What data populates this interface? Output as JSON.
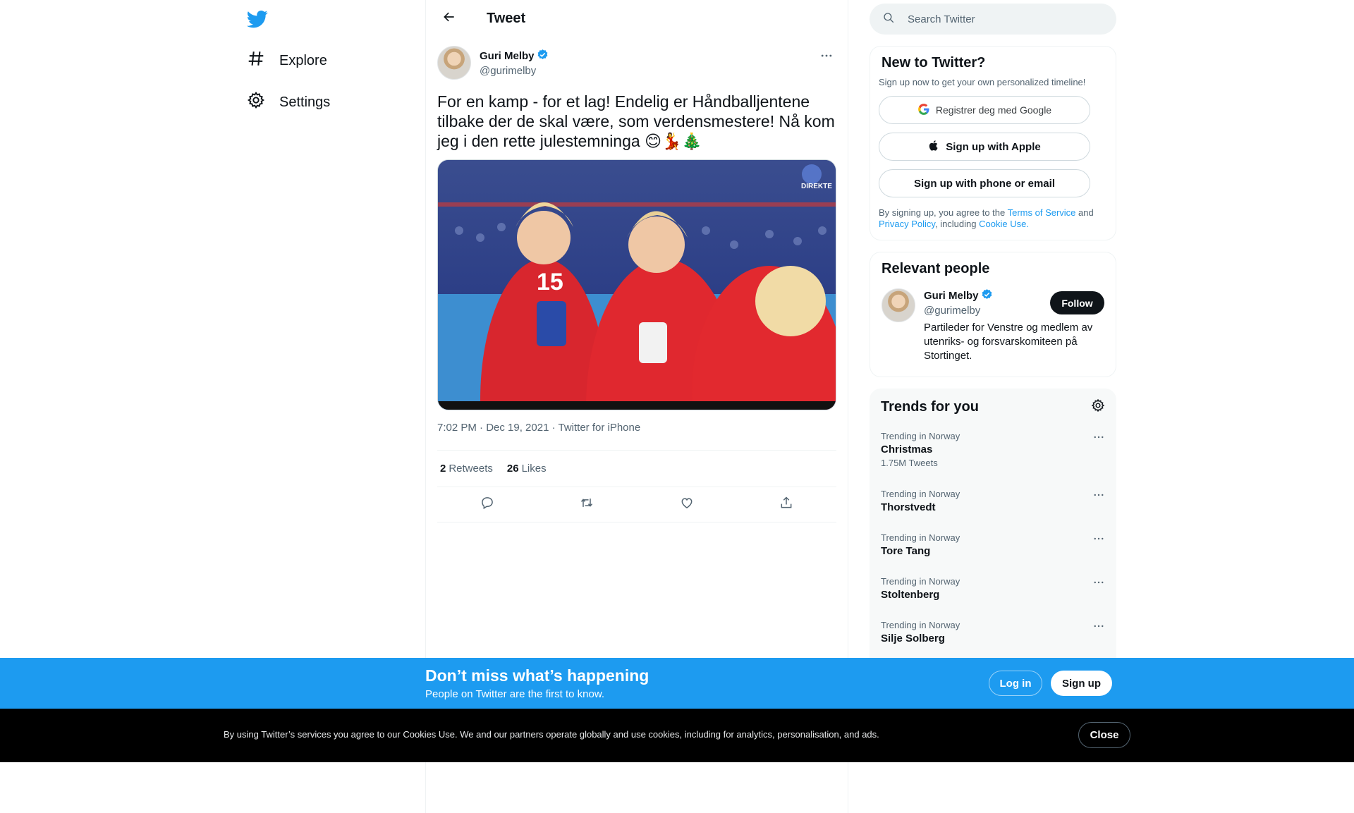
{
  "nav": {
    "explore_label": "Explore",
    "settings_label": "Settings"
  },
  "header": {
    "title": "Tweet"
  },
  "tweet": {
    "author_name": "Guri Melby",
    "author_handle": "@gurimelby",
    "text": "For en kamp - for et lag! Endelig er Håndballjentene tilbake der de skal være, som verdensmestere! Nå kom jeg i den rette julestemninga 😊💃🎄",
    "media_overlay_label": "DIREKTE",
    "jersey_number": "15",
    "meta": "7:02 PM · Dec 19, 2021 · Twitter for iPhone",
    "retweets_count": "2",
    "retweets_label": "Retweets",
    "likes_count": "26",
    "likes_label": "Likes"
  },
  "search": {
    "placeholder": "Search Twitter"
  },
  "signup": {
    "title": "New to Twitter?",
    "subtitle": "Sign up now to get your own personalized timeline!",
    "google_label": "Registrer deg med Google",
    "apple_label": "Sign up with Apple",
    "phone_label": "Sign up with phone or email",
    "legal_prefix": "By signing up, you agree to the ",
    "terms_link": "Terms of Service",
    "legal_and": " and",
    "privacy_link": "Privacy Policy",
    "legal_including": ", including ",
    "cookie_link": "Cookie Use."
  },
  "relevant": {
    "title": "Relevant people",
    "name": "Guri Melby",
    "handle": "@gurimelby",
    "bio": "Partileder for Venstre og medlem av utenriks- og forsvarskomiteen på Stortinget.",
    "follow_label": "Follow"
  },
  "trends": {
    "title": "Trends for you",
    "items": [
      {
        "context": "Trending in Norway",
        "name": "Christmas",
        "count": "1.75M Tweets"
      },
      {
        "context": "Trending in Norway",
        "name": "Thorstvedt"
      },
      {
        "context": "Trending in Norway",
        "name": "Tore Tang"
      },
      {
        "context": "Trending in Norway",
        "name": "Stoltenberg"
      },
      {
        "context": "Trending in Norway",
        "name": "Silje Solberg"
      }
    ]
  },
  "promo": {
    "title": "Don’t miss what’s happening",
    "subtitle": "People on Twitter are the first to know.",
    "login_label": "Log in",
    "signup_label": "Sign up"
  },
  "cookie": {
    "text": "By using Twitter’s services you agree to our Cookies Use. We and our partners operate globally and use cookies, including for analytics, personalisation, and ads.",
    "close_label": "Close"
  },
  "colors": {
    "brand": "#1d9bf0",
    "text": "#0f1419",
    "secondary": "#536471"
  }
}
